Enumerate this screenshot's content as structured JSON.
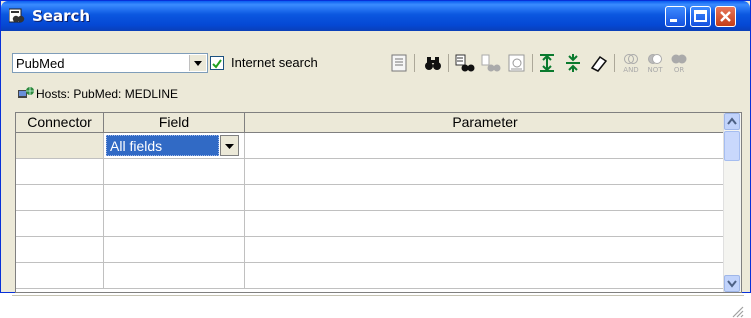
{
  "window": {
    "title": "Search"
  },
  "toolbar": {
    "database": "PubMed",
    "internet_search_label": "Internet search",
    "internet_search_checked": true,
    "tools": [
      {
        "name": "query-text-icon"
      },
      {
        "name": "binoculars-icon"
      },
      {
        "name": "find-in-results-icon"
      },
      {
        "name": "find-disabled-icon"
      },
      {
        "name": "search-disabled-icon"
      },
      {
        "name": "insert-row-icon"
      },
      {
        "name": "delete-row-icon"
      },
      {
        "name": "eraser-icon"
      },
      {
        "name": "and-connector-icon",
        "label": "AND"
      },
      {
        "name": "not-connector-icon",
        "label": "NOT"
      },
      {
        "name": "or-connector-icon",
        "label": "OR"
      }
    ]
  },
  "hosts": {
    "text": "Hosts: PubMed: MEDLINE"
  },
  "grid": {
    "headers": {
      "connector": "Connector",
      "field": "Field",
      "parameter": "Parameter"
    },
    "first_row_field": "All fields",
    "row_count": 6
  },
  "colors": {
    "titlebar": "#0548d4",
    "selection": "#316ac5",
    "face": "#ece9d8"
  }
}
